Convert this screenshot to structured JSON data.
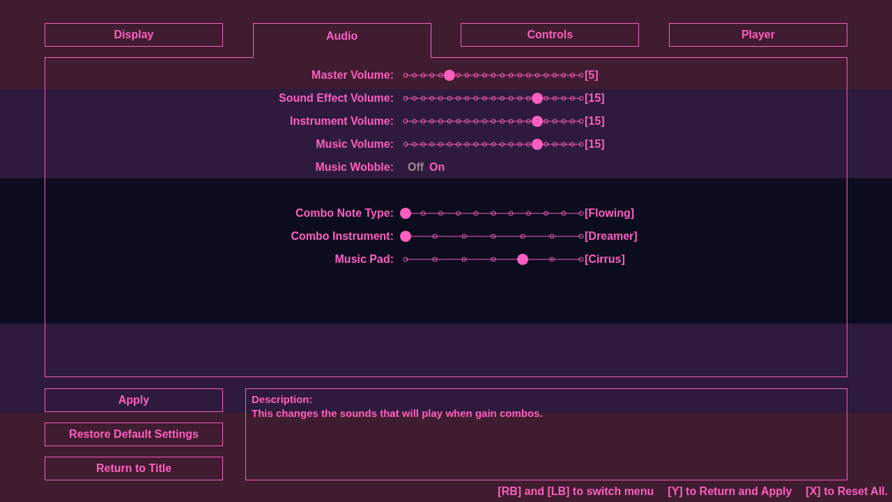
{
  "tabs": [
    {
      "label": "Display",
      "selected": false
    },
    {
      "label": "Audio",
      "selected": true
    },
    {
      "label": "Controls",
      "selected": false
    },
    {
      "label": "Player",
      "selected": false
    }
  ],
  "settings": [
    {
      "kind": "slider",
      "label": "Master Volume:",
      "reading": "[5]",
      "notches": [
        {
          "selected": false
        },
        {
          "selected": false
        },
        {
          "selected": false
        },
        {
          "selected": false
        },
        {
          "selected": false
        },
        {
          "selected": true
        },
        {
          "selected": false
        },
        {
          "selected": false
        },
        {
          "selected": false
        },
        {
          "selected": false
        },
        {
          "selected": false
        },
        {
          "selected": false
        },
        {
          "selected": false
        },
        {
          "selected": false
        },
        {
          "selected": false
        },
        {
          "selected": false
        },
        {
          "selected": false
        },
        {
          "selected": false
        },
        {
          "selected": false
        },
        {
          "selected": false
        },
        {
          "selected": false
        }
      ]
    },
    {
      "kind": "slider",
      "label": "Sound Effect Volume:",
      "reading": "[15]",
      "notches": [
        {
          "selected": false
        },
        {
          "selected": false
        },
        {
          "selected": false
        },
        {
          "selected": false
        },
        {
          "selected": false
        },
        {
          "selected": false
        },
        {
          "selected": false
        },
        {
          "selected": false
        },
        {
          "selected": false
        },
        {
          "selected": false
        },
        {
          "selected": false
        },
        {
          "selected": false
        },
        {
          "selected": false
        },
        {
          "selected": false
        },
        {
          "selected": false
        },
        {
          "selected": true
        },
        {
          "selected": false
        },
        {
          "selected": false
        },
        {
          "selected": false
        },
        {
          "selected": false
        },
        {
          "selected": false
        }
      ]
    },
    {
      "kind": "slider",
      "label": "Instrument Volume:",
      "reading": "[15]",
      "notches": [
        {
          "selected": false
        },
        {
          "selected": false
        },
        {
          "selected": false
        },
        {
          "selected": false
        },
        {
          "selected": false
        },
        {
          "selected": false
        },
        {
          "selected": false
        },
        {
          "selected": false
        },
        {
          "selected": false
        },
        {
          "selected": false
        },
        {
          "selected": false
        },
        {
          "selected": false
        },
        {
          "selected": false
        },
        {
          "selected": false
        },
        {
          "selected": false
        },
        {
          "selected": true
        },
        {
          "selected": false
        },
        {
          "selected": false
        },
        {
          "selected": false
        },
        {
          "selected": false
        },
        {
          "selected": false
        }
      ]
    },
    {
      "kind": "slider",
      "label": "Music Volume:",
      "reading": "[15]",
      "notches": [
        {
          "selected": false
        },
        {
          "selected": false
        },
        {
          "selected": false
        },
        {
          "selected": false
        },
        {
          "selected": false
        },
        {
          "selected": false
        },
        {
          "selected": false
        },
        {
          "selected": false
        },
        {
          "selected": false
        },
        {
          "selected": false
        },
        {
          "selected": false
        },
        {
          "selected": false
        },
        {
          "selected": false
        },
        {
          "selected": false
        },
        {
          "selected": false
        },
        {
          "selected": true
        },
        {
          "selected": false
        },
        {
          "selected": false
        },
        {
          "selected": false
        },
        {
          "selected": false
        },
        {
          "selected": false
        }
      ]
    },
    {
      "kind": "toggle",
      "label": "Music Wobble:",
      "options": [
        {
          "label": "Off",
          "selected": false
        },
        {
          "label": "On",
          "selected": true
        }
      ]
    },
    {
      "kind": "spacer"
    },
    {
      "kind": "slider",
      "label": "Combo Note Type:",
      "reading": "[Flowing]",
      "notches": [
        {
          "selected": true
        },
        {
          "selected": false
        },
        {
          "selected": false
        },
        {
          "selected": false
        },
        {
          "selected": false
        },
        {
          "selected": false
        },
        {
          "selected": false
        },
        {
          "selected": false
        },
        {
          "selected": false
        },
        {
          "selected": false
        },
        {
          "selected": false
        }
      ]
    },
    {
      "kind": "slider",
      "label": "Combo Instrument:",
      "reading": "[Dreamer]",
      "notches": [
        {
          "selected": true
        },
        {
          "selected": false
        },
        {
          "selected": false
        },
        {
          "selected": false
        },
        {
          "selected": false
        },
        {
          "selected": false
        },
        {
          "selected": false
        }
      ]
    },
    {
      "kind": "slider",
      "label": "Music Pad:",
      "reading": "[Cirrus]",
      "notches": [
        {
          "selected": false
        },
        {
          "selected": false
        },
        {
          "selected": false
        },
        {
          "selected": false
        },
        {
          "selected": true
        },
        {
          "selected": false
        },
        {
          "selected": false
        }
      ]
    }
  ],
  "buttons": [
    "Apply",
    "Restore Default Settings",
    "Return to Title"
  ],
  "description": {
    "heading": "Description:",
    "text": "This changes the sounds that will play when gain combos."
  },
  "hints": [
    "[RB] and [LB] to switch menu",
    "[Y] to Return and Apply",
    "[X] to Reset All."
  ]
}
